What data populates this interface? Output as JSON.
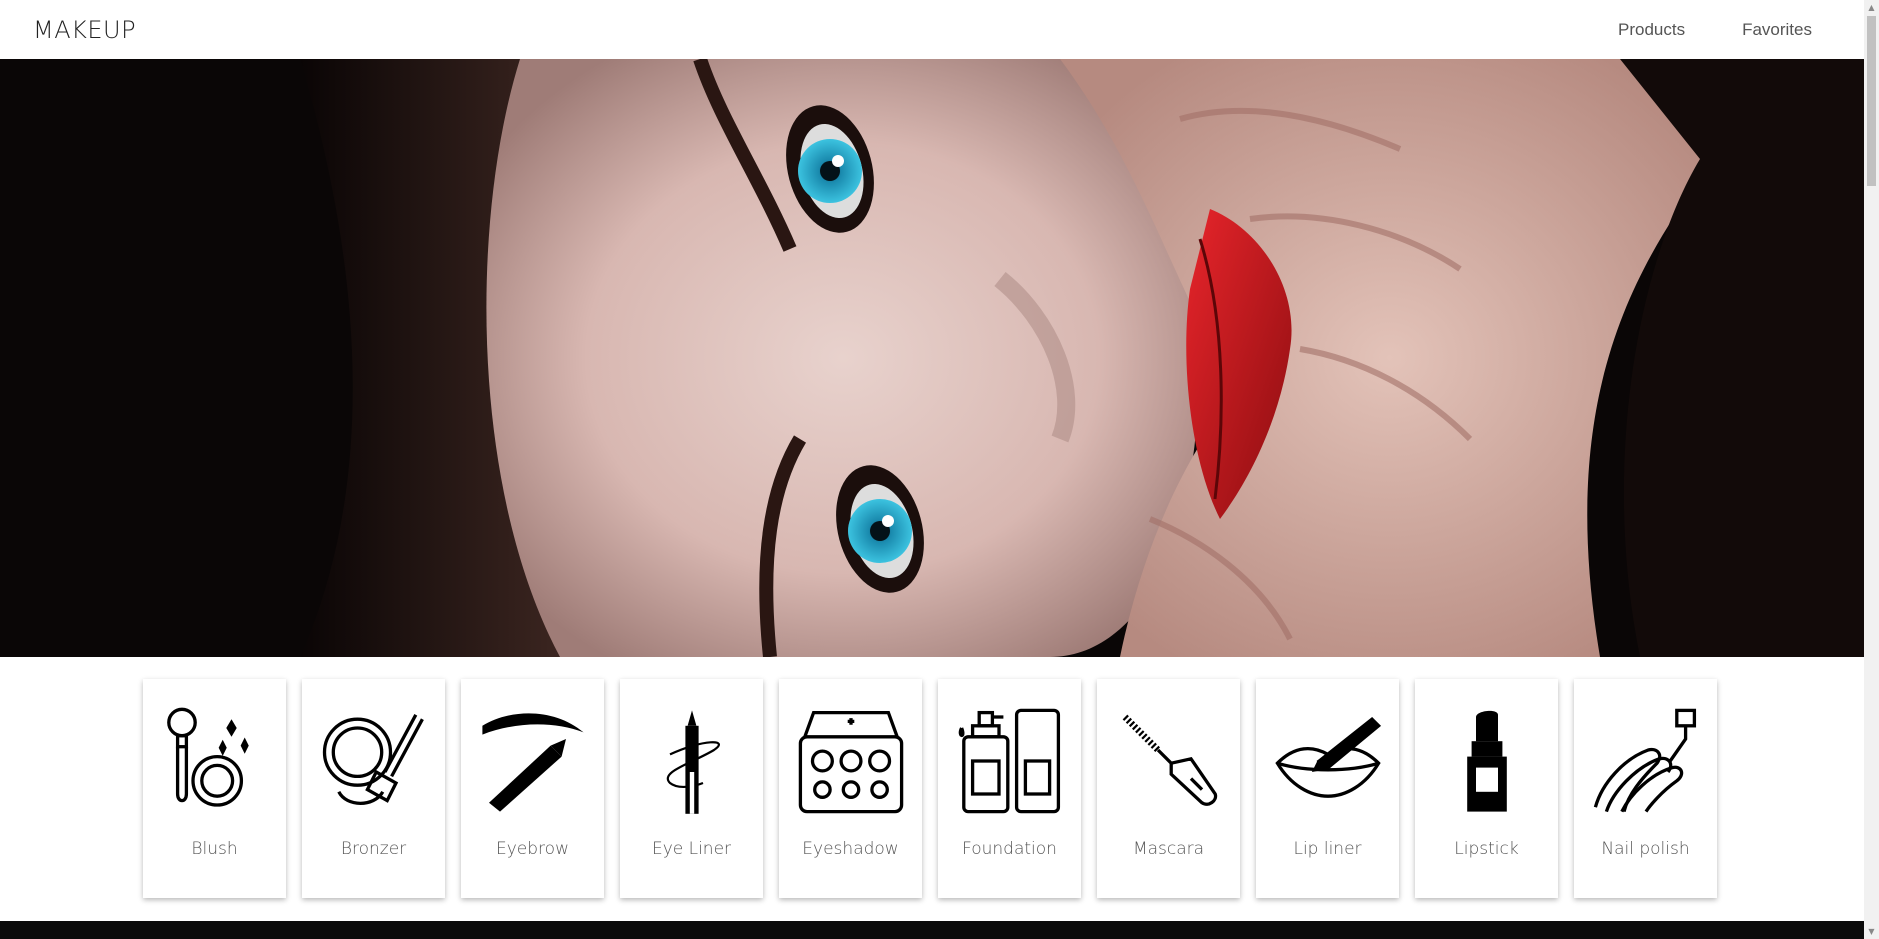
{
  "header": {
    "logo": "MAKEUP",
    "nav": [
      {
        "label": "Products"
      },
      {
        "label": "Favorites"
      }
    ]
  },
  "hero": {
    "image": "woman-face-red-lips-photo"
  },
  "categories": [
    {
      "label": "Blush",
      "icon": "blush-brush-icon"
    },
    {
      "label": "Bronzer",
      "icon": "bronzer-compact-icon"
    },
    {
      "label": "Eyebrow",
      "icon": "eyebrow-pencil-icon"
    },
    {
      "label": "Eye Liner",
      "icon": "eye-liner-pen-icon"
    },
    {
      "label": "Eyeshadow",
      "icon": "eyeshadow-palette-icon"
    },
    {
      "label": "Foundation",
      "icon": "foundation-bottle-icon"
    },
    {
      "label": "Mascara",
      "icon": "mascara-wand-icon"
    },
    {
      "label": "Lip liner",
      "icon": "lip-liner-icon"
    },
    {
      "label": "Lipstick",
      "icon": "lipstick-icon"
    },
    {
      "label": "Nail polish",
      "icon": "nail-polish-icon"
    }
  ],
  "colors": {
    "accent_lips": "#c8191e",
    "eye_blue": "#2aa7c9",
    "footer": "#0b0b0b"
  }
}
